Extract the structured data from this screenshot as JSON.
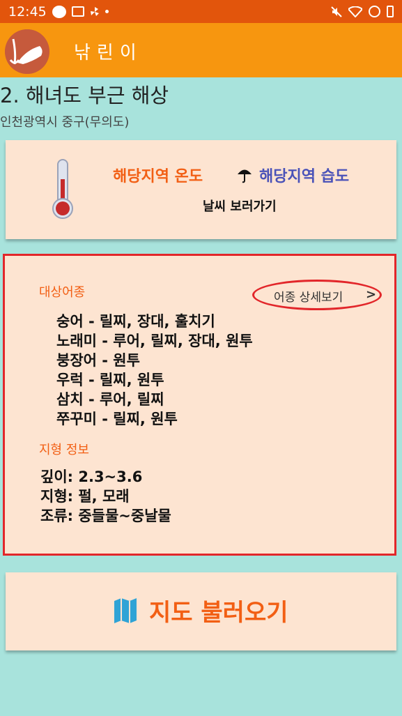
{
  "status_bar": {
    "time": "12:45"
  },
  "app": {
    "title": "낚린이"
  },
  "page": {
    "title": "2. 해녀도 부근 해상",
    "subtitle": "인천광역시 중구(무의도)"
  },
  "weather": {
    "temp_label": "해당지역 온도",
    "humidity_label": "해당지역 습도",
    "link": "날씨 보러가기"
  },
  "fish": {
    "section_label": "대상어종",
    "detail_link": "어종 상세보기",
    "detail_chevron": ">",
    "items": [
      "숭어 - 릴찌, 장대, 훌치기",
      "노래미 - 루어, 릴찌, 장대, 원투",
      "붕장어 - 원투",
      "우럭 - 릴찌, 원투",
      "삼치 - 루어, 릴찌",
      "쭈꾸미 - 릴찌, 원투"
    ]
  },
  "terrain": {
    "section_label": "지형 정보",
    "items": [
      "깊이: 2.3~3.6",
      "지형: 펄, 모래",
      "조류: 중들물~중날물"
    ]
  },
  "map": {
    "label": "지도 불러오기"
  }
}
